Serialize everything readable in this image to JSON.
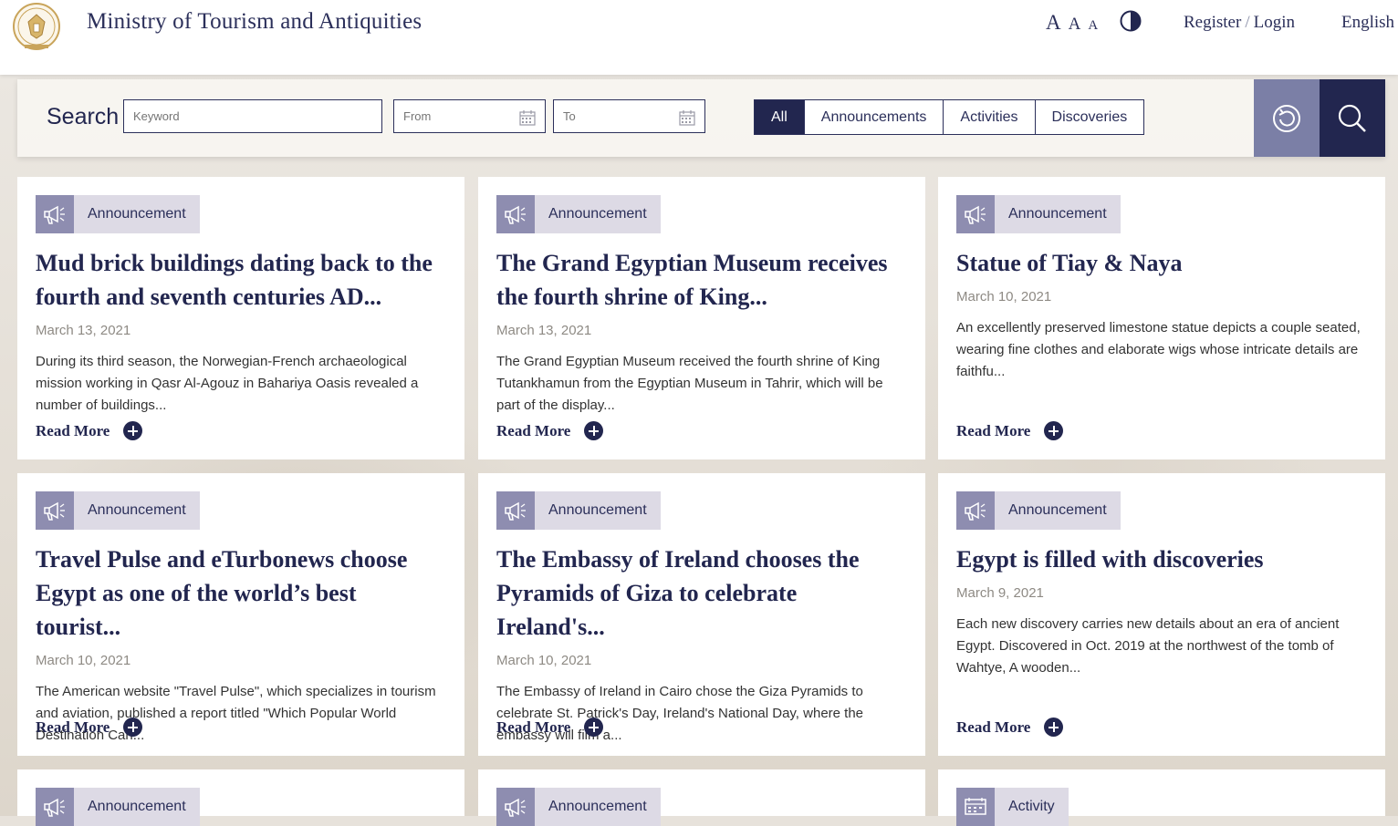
{
  "header": {
    "site_title": "Ministry of Tourism and Antiquities",
    "font_sizes": [
      "A",
      "A",
      "A"
    ],
    "register": "Register",
    "separator": "/",
    "login": "Login",
    "language": "English"
  },
  "search": {
    "label": "Search",
    "keyword_placeholder": "Keyword",
    "from_placeholder": "From",
    "to_placeholder": "To",
    "filters": [
      "All",
      "Announcements",
      "Activities",
      "Discoveries"
    ],
    "active_filter": "All"
  },
  "colors": {
    "primary": "#22264f",
    "reset_button": "#7b7fa6",
    "tag_icon_bg": "#8e8db0",
    "tag_label_bg": "#dddae5"
  },
  "read_more_label": "Read More",
  "cards": [
    {
      "tag": "Announcement",
      "icon": "megaphone-icon",
      "title": "Mud brick buildings dating back to the fourth and seventh centuries AD...",
      "date": "March 13, 2021",
      "description": "During its third season, the Norwegian-French archaeological mission working in Qasr Al-Agouz in Bahariya Oasis revealed a number of buildings..."
    },
    {
      "tag": "Announcement",
      "icon": "megaphone-icon",
      "title": "The Grand Egyptian Museum receives the fourth shrine of King...",
      "date": "March 13, 2021",
      "description": "The Grand Egyptian Museum received the fourth shrine of King Tutankhamun from the Egyptian Museum in Tahrir, which will be part of the display..."
    },
    {
      "tag": "Announcement",
      "icon": "megaphone-icon",
      "title": "Statue of Tiay & Naya",
      "date": "March 10, 2021",
      "description": "An excellently preserved limestone statue depicts a couple seated, wearing fine clothes and elaborate wigs whose intricate details are faithfu..."
    },
    {
      "tag": "Announcement",
      "icon": "megaphone-icon",
      "title": "Travel Pulse and eTurbonews choose Egypt as one of the world’s best tourist...",
      "date": "March 10, 2021",
      "description": "The American website \"Travel Pulse\", which specializes in tourism and aviation, published a report titled \"Which Popular World Destination Can..."
    },
    {
      "tag": "Announcement",
      "icon": "megaphone-icon",
      "title": "The Embassy of Ireland chooses the Pyramids of Giza to celebrate Ireland's...",
      "date": "March 10, 2021",
      "description": "The Embassy of Ireland in Cairo chose the Giza Pyramids to celebrate St. Patrick's Day, Ireland's National Day, where the embassy will film a..."
    },
    {
      "tag": "Announcement",
      "icon": "megaphone-icon",
      "title": "Egypt is filled with discoveries",
      "date": "March 9, 2021",
      "description": "Each new discovery carries new details about an era of ancient Egypt. Discovered in Oct. 2019 at the northwest of the tomb of Wahtye, A wooden..."
    },
    {
      "tag": "Announcement",
      "icon": "megaphone-icon"
    },
    {
      "tag": "Announcement",
      "icon": "megaphone-icon"
    },
    {
      "tag": "Activity",
      "icon": "activity-icon"
    }
  ]
}
